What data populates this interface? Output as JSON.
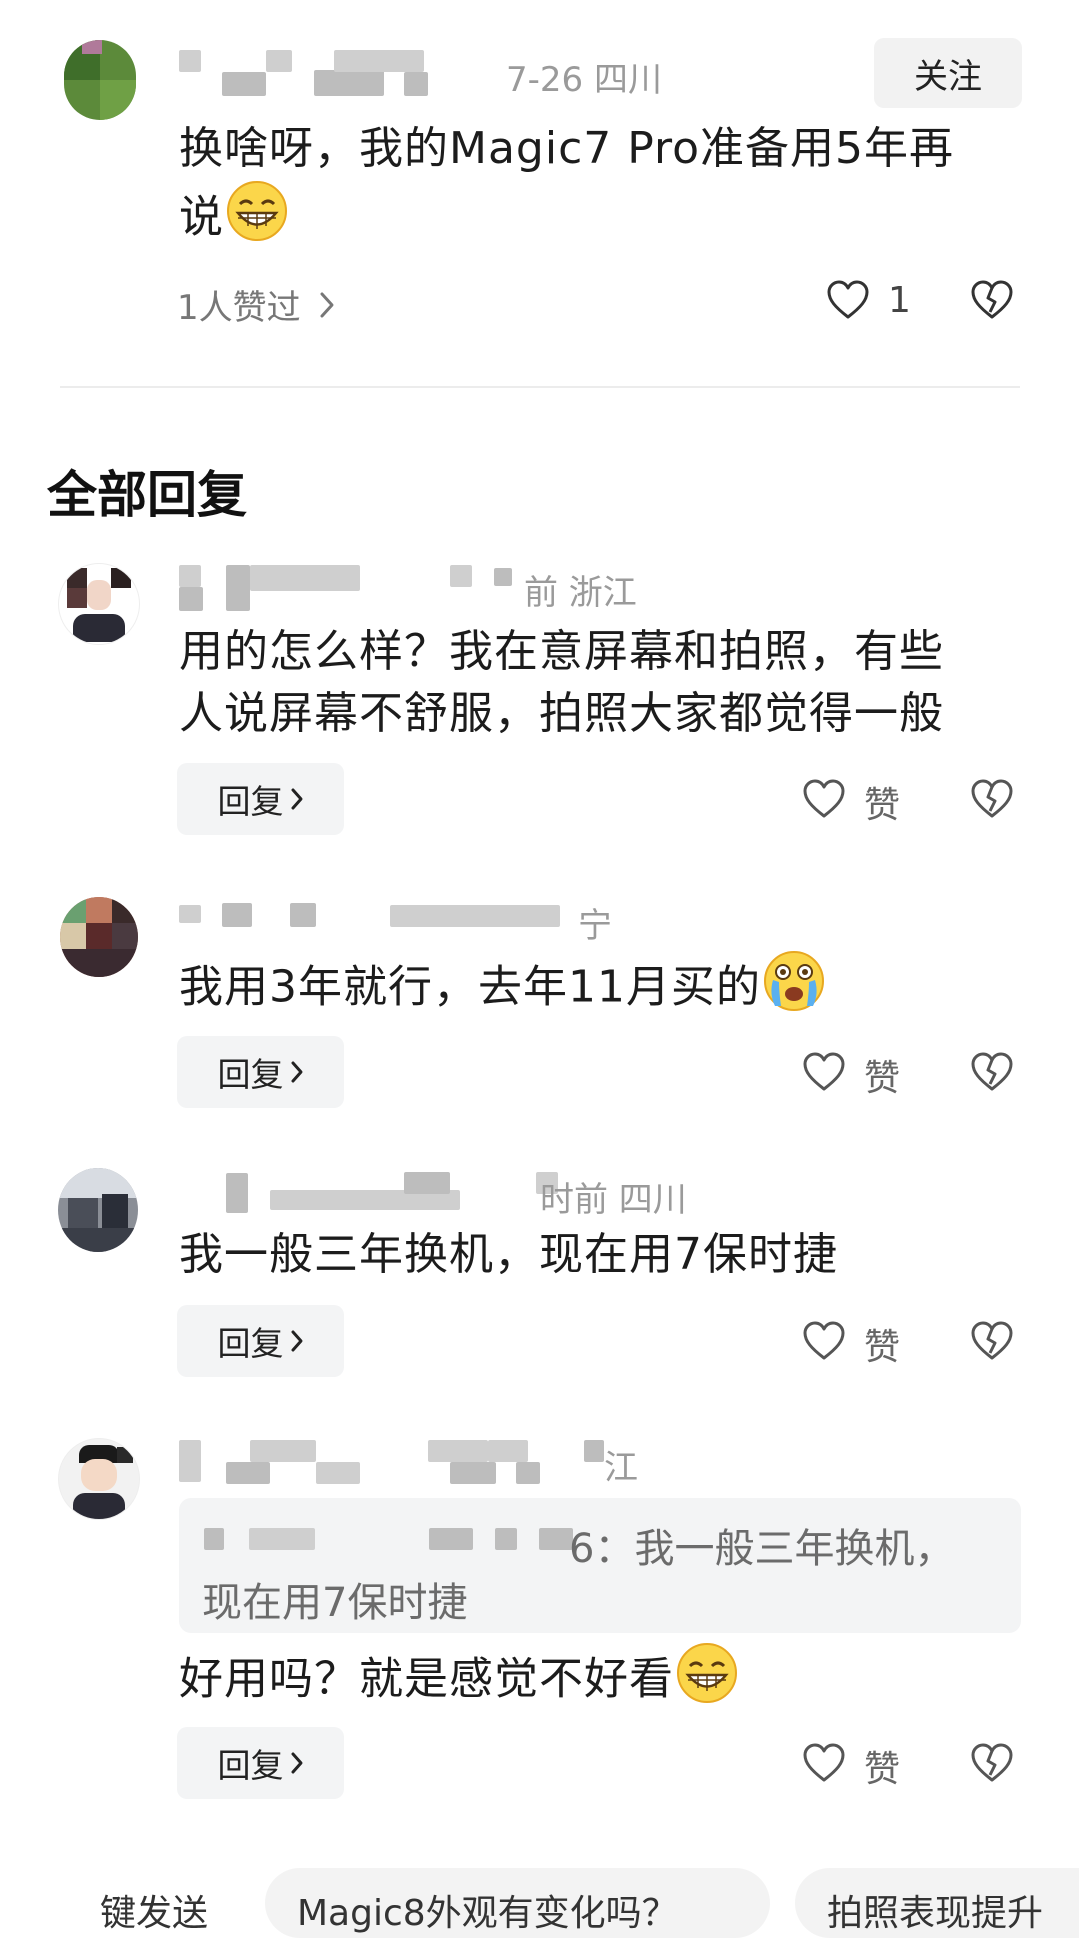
{
  "main_comment": {
    "meta": "7-26  四川",
    "follow_label": "关注",
    "content_line1": "换啥呀，我的Magic7 Pro准备用5年再",
    "content_line2": "说",
    "likers_text": "1人赞过",
    "like_count": "1"
  },
  "replies_section": {
    "title": "全部回复"
  },
  "replies": [
    {
      "meta": "前  浙江",
      "content_line1": "用的怎么样？我在意屏幕和拍照，有些",
      "content_line2": "人说屏幕不舒服，拍照大家都觉得一般",
      "reply_label": "回复",
      "like_label": "赞"
    },
    {
      "meta": "宁",
      "content": "我用3年就行，去年11月买的",
      "reply_label": "回复",
      "like_label": "赞"
    },
    {
      "meta": "时前  四川",
      "content": "我一般三年换机，现在用7保时捷",
      "reply_label": "回复",
      "like_label": "赞"
    },
    {
      "meta": "江",
      "quote_line1": "6：我一般三年换机，",
      "quote_line2": "现在用7保时捷",
      "content": "好用吗？就是感觉不好看",
      "reply_label": "回复",
      "like_label": "赞"
    }
  ],
  "bottom_chips": [
    "键发送",
    "Magic8外观有变化吗？",
    "拍照表现提升"
  ],
  "icons": {
    "like": "heart-outline-icon",
    "dislike": "broken-heart-icon",
    "chevron": "chevron-right-icon",
    "emoji_grin": "grinning-emoji-icon",
    "emoji_cry": "crying-emoji-icon"
  },
  "colors": {
    "meta_text": "#9a9a9a",
    "button_bg": "#f3f4f5",
    "quote_text": "#6b6b6b"
  }
}
